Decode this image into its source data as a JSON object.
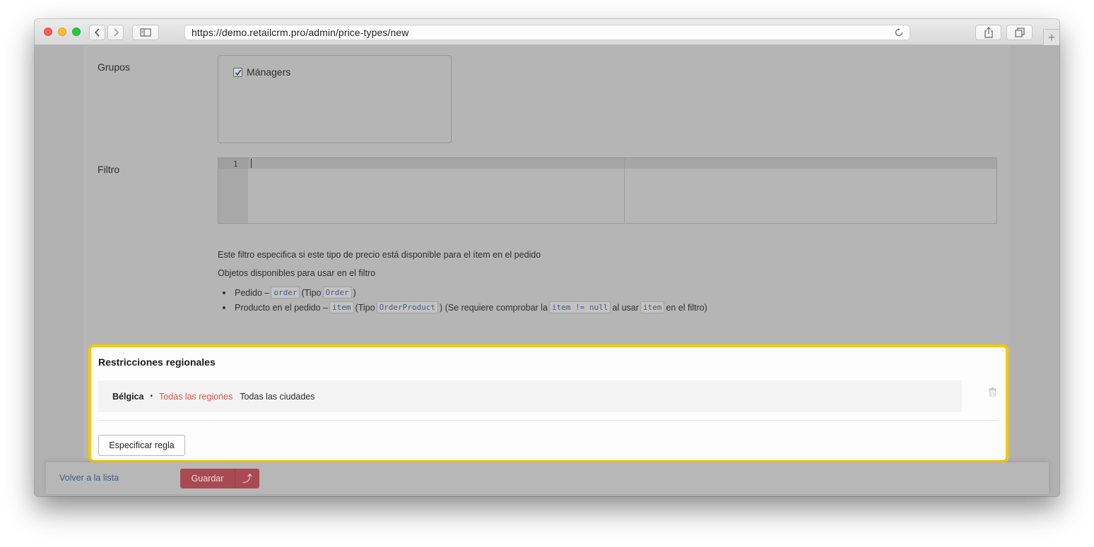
{
  "browser": {
    "url": "https://demo.retailcrm.pro/admin/price-types/new",
    "new_tab_symbol": "+"
  },
  "form": {
    "groups_label": "Grupos",
    "group_option": "Mánagers",
    "group_checked": true,
    "filter_label": "Filtro",
    "editor_line_number": "1",
    "filter_help": "Este filtro especifica si este tipo de precio está disponible para el ítem en el pedido",
    "objects_help": "Objetos disponibles para usar en el filtro",
    "objects": [
      {
        "prefix": "Pedido –",
        "code": "order",
        "type_open": "(Tipo",
        "type_code": "Order",
        "type_close": ")"
      },
      {
        "prefix": "Producto en el pedido –",
        "code": "item",
        "type_open": "(Tipo",
        "type_code": "OrderProduct",
        "middle": ") (Se requiere comprobar la",
        "check_code": "item != null",
        "use_text": "al usar",
        "use_code": "item",
        "tail": "en el filtro)"
      }
    ]
  },
  "regional": {
    "title": "Restricciones regionales",
    "rule": {
      "country": "Bélgica",
      "separator": "•",
      "regions": "Todas las regiones",
      "cities": "Todas las ciudades"
    },
    "add_rule_label": "Especificar regla",
    "highlight_color": "#f5c900",
    "regions_color": "#e0534b"
  },
  "footer": {
    "back_label": "Volver a la lista",
    "save_label": "Guardar",
    "save_more_symbol": "⤴",
    "save_color": "#a94a52"
  }
}
